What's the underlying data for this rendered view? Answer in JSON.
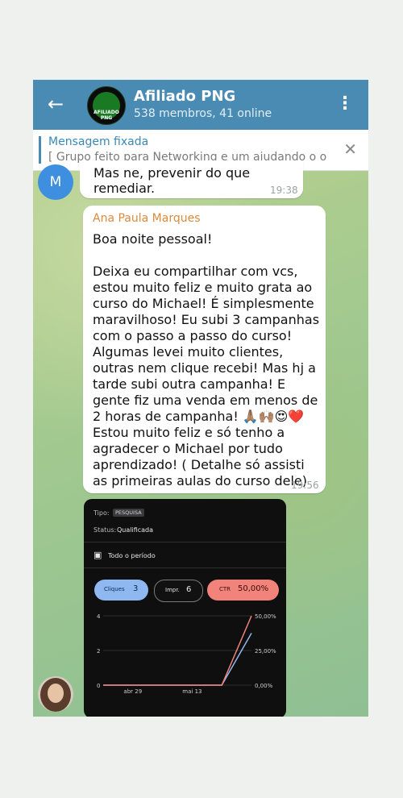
{
  "header": {
    "back_icon": "←",
    "avatar_text": "AFILIADO PNG",
    "title": "Afiliado PNG",
    "subtitle": "538 membros, 41 online",
    "menu_icon": "⋮"
  },
  "pinned": {
    "label": "Mensagem fixada",
    "snippet": "[ Grupo feito para Networking e um ajudando o out...",
    "close_icon": "✕"
  },
  "messages": [
    {
      "avatar_letter": "M",
      "text": "Mas ne, prevenir do que remediar.",
      "time": "19:38"
    },
    {
      "sender": "Ana Paula Marques",
      "body": "Boa noite pessoal!\n\nDeixa eu compartilhar com vcs, estou muito feliz e muito grata ao curso do Michael! É simplesmente maravilhoso! Eu subi 3 campanhas com o passo a passo do curso! Algumas levei muito clientes, outras nem clique recebi! Mas hj a tarde subi outra campanha! E gente fiz uma venda em menos de 2 horas de campanha! 🙏🏽🙌🏽😍❤️\nEstou muito feliz e só tenho a agradecer o Michael por tudo aprendizado! ( Detalhe só assisti as primeiras aulas do curso dele)",
      "time": "19:56"
    }
  ],
  "screenshot": {
    "tipo_label": "Tipo:",
    "tipo_value": "PESQUISA",
    "status_label": "Status:",
    "status_value": "Qualificada",
    "period_label": "Todo o período",
    "pills": [
      {
        "label": "Cliques",
        "value": "3",
        "color": "#8fb8f0"
      },
      {
        "label": "Impr.",
        "value": "6",
        "color": "#111111"
      },
      {
        "label": "CTR",
        "value": "50,00%",
        "color": "#f2837b"
      }
    ]
  },
  "chart_data": {
    "type": "line",
    "x": [
      "",
      "abr 29",
      "",
      "mai 13",
      "",
      ""
    ],
    "left_ticks": [
      "4",
      "2",
      "0"
    ],
    "right_ticks": [
      "50,00%",
      "25,00%",
      "0,00%"
    ],
    "ylim": [
      0,
      4
    ],
    "series": [
      {
        "values": [
          0,
          0,
          0,
          0,
          0,
          3
        ],
        "color": "#8fb8f0"
      },
      {
        "values": [
          0,
          0,
          0,
          0,
          0,
          4
        ],
        "color": "#f2837b"
      }
    ]
  }
}
